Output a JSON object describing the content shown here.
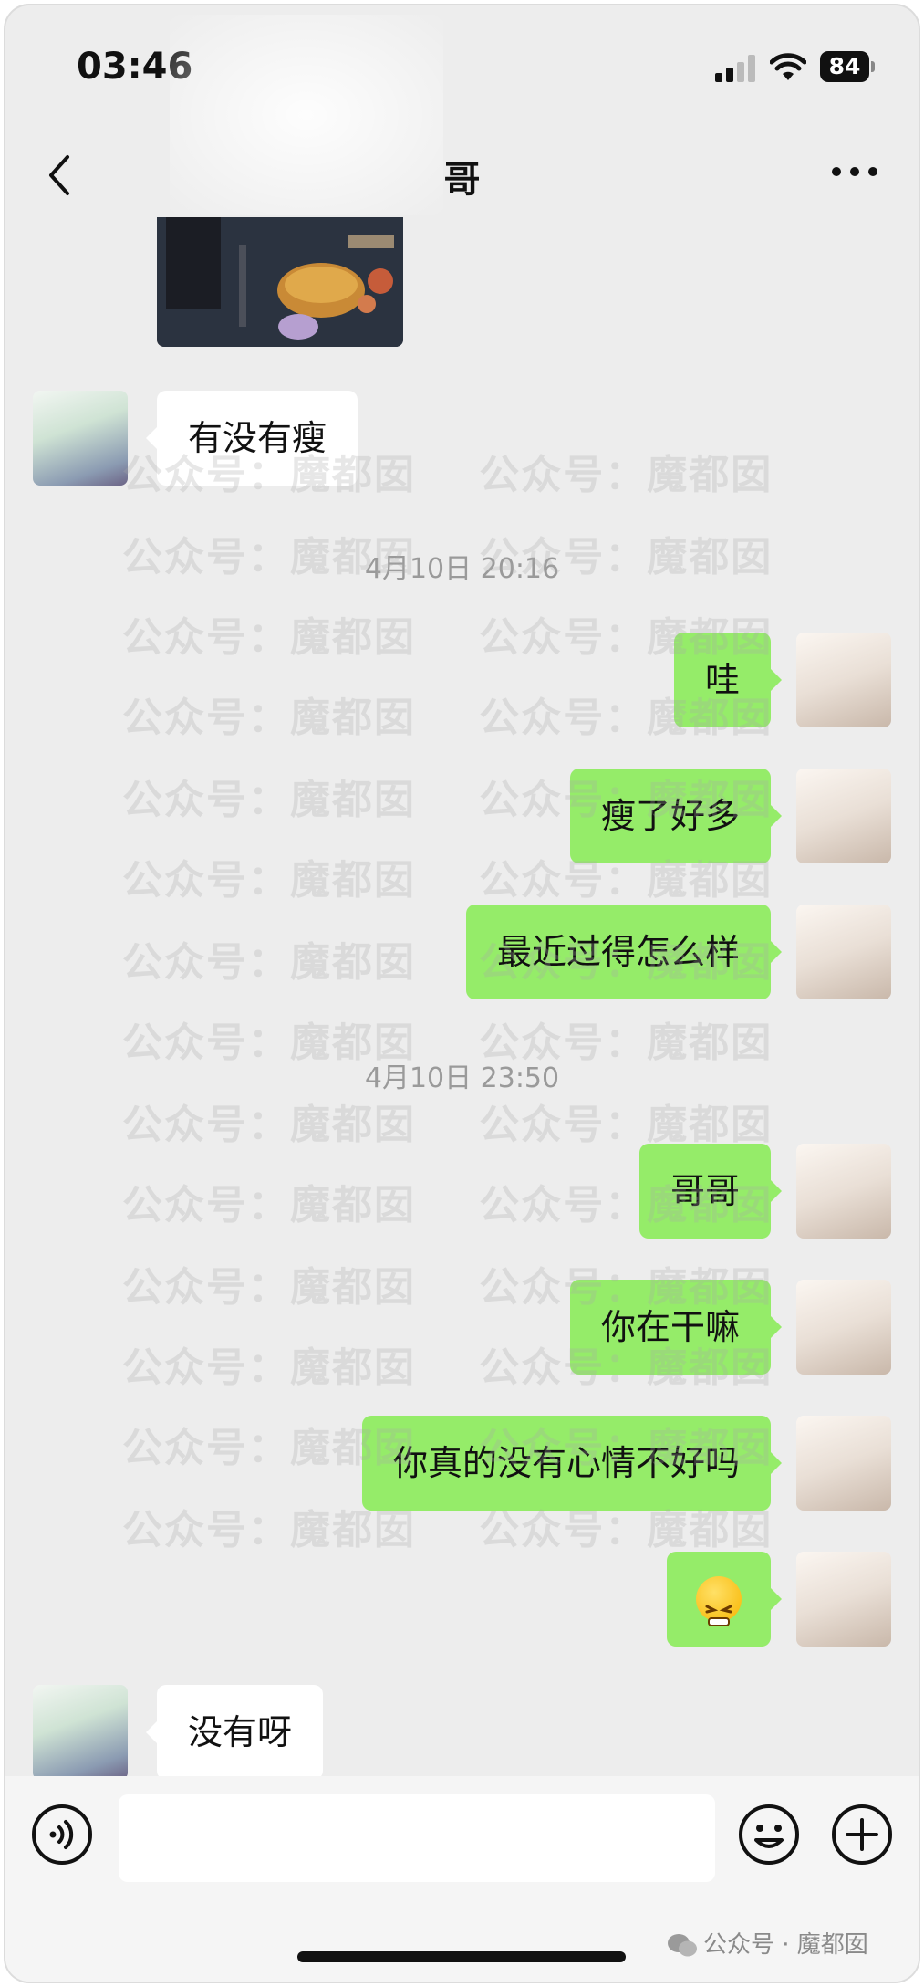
{
  "status_bar": {
    "time": "03:46",
    "battery": "84"
  },
  "header": {
    "title": "哥"
  },
  "messages": [
    {
      "text": "有没有瘦"
    },
    {
      "timestamp": "4月10日 20:16"
    },
    {
      "text": "哇"
    },
    {
      "text": "瘦了好多"
    },
    {
      "text": "最近过得怎么样"
    },
    {
      "timestamp": "4月10日 23:50"
    },
    {
      "text": "哥哥"
    },
    {
      "text": "你在干嘛"
    },
    {
      "text": "你真的没有心情不好吗"
    },
    {
      "text": "没有呀"
    }
  ],
  "watermark": {
    "text": "公众号：魔都囡"
  },
  "footer": {
    "watermark": "公众号 · 魔都囡"
  },
  "colors": {
    "outgoing_bubble": "#95ec69",
    "incoming_bubble": "#ffffff",
    "background": "#ededed"
  }
}
